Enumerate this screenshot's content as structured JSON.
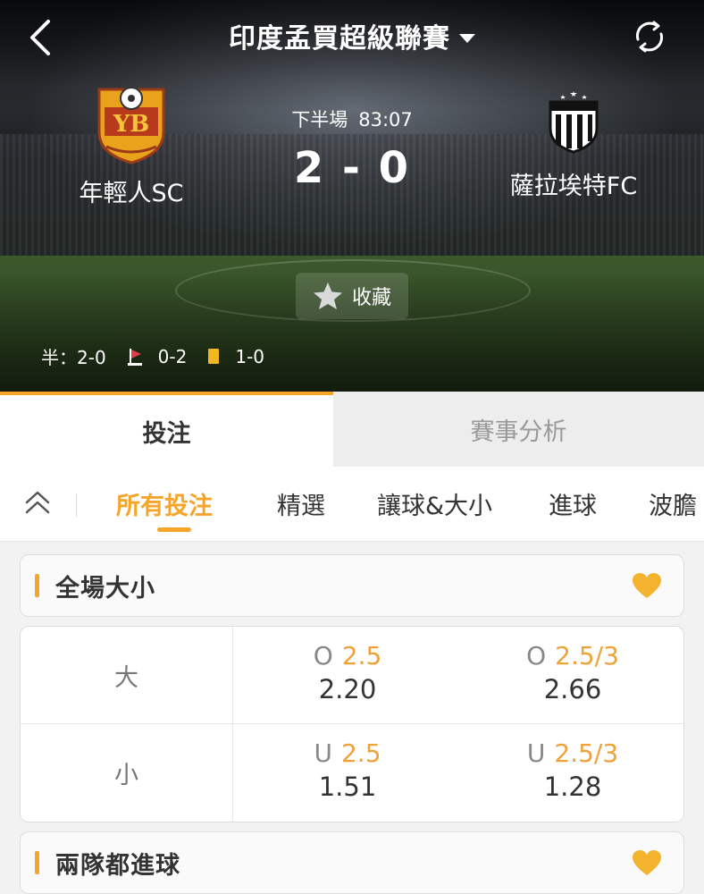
{
  "header": {
    "league_title": "印度孟買超級聯賽",
    "home": {
      "name": "年輕人SC",
      "logo_text": "YB"
    },
    "away": {
      "name": "薩拉埃特FC"
    },
    "period": "下半場",
    "clock": "83:07",
    "score": "2 - 0",
    "favorite_label": "收藏",
    "half_time": "半：2-0",
    "corners": "0-2",
    "yellow_cards": "1-0"
  },
  "main_tabs": [
    {
      "label": "投注",
      "active": true
    },
    {
      "label": "賽事分析",
      "active": false
    }
  ],
  "sub_tabs": [
    {
      "label": "所有投注",
      "active": true
    },
    {
      "label": "精選"
    },
    {
      "label": "讓球&大小"
    },
    {
      "label": "進球"
    },
    {
      "label": "波膽"
    }
  ],
  "markets": [
    {
      "title": "全場大小",
      "rows": [
        {
          "label": "大",
          "cells": [
            {
              "prefix": "O",
              "line": "2.5",
              "price": "2.20"
            },
            {
              "prefix": "O",
              "line": "2.5/3",
              "price": "2.66"
            }
          ]
        },
        {
          "label": "小",
          "cells": [
            {
              "prefix": "U",
              "line": "2.5",
              "price": "1.51"
            },
            {
              "prefix": "U",
              "line": "2.5/3",
              "price": "1.28"
            }
          ]
        }
      ]
    },
    {
      "title": "兩隊都進球"
    }
  ],
  "colors": {
    "accent": "#f4a52a",
    "odds_line": "#f0a238",
    "heart": "#f4b32e"
  }
}
